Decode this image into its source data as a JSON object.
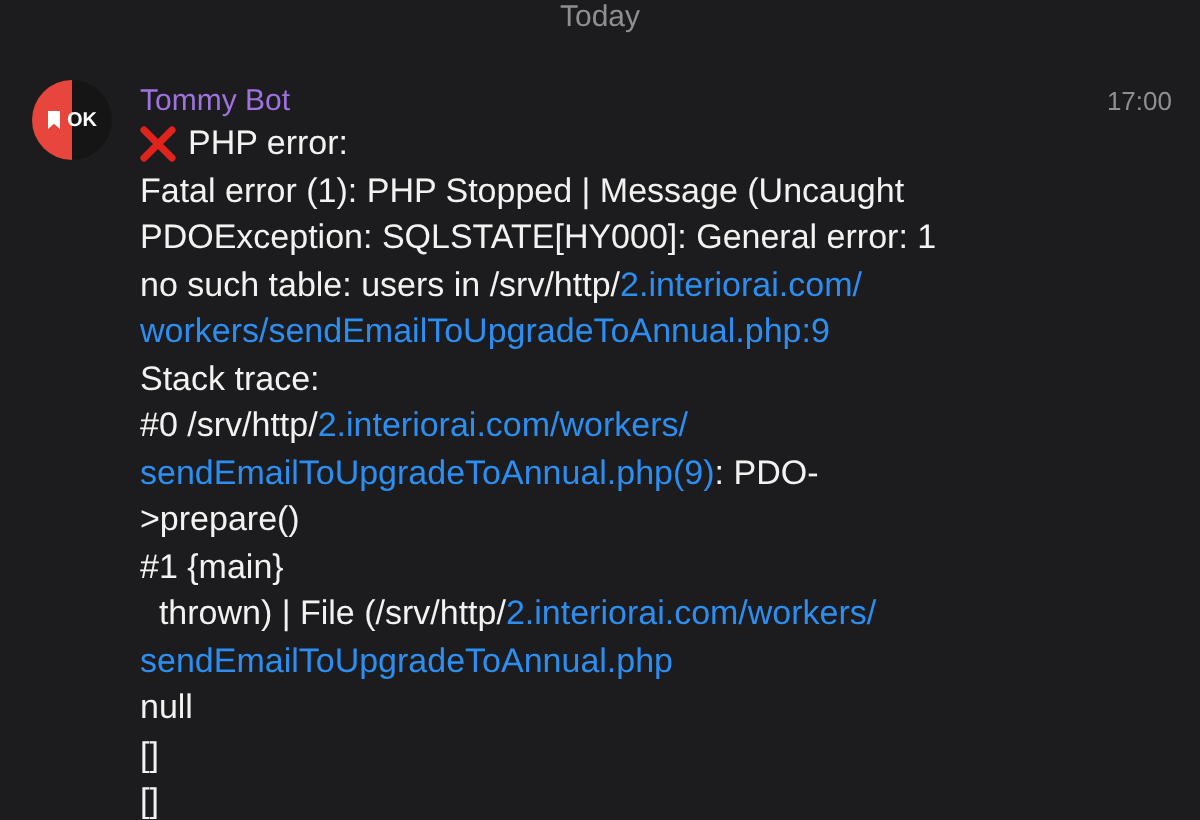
{
  "date_header": "Today",
  "message": {
    "avatar_text": "OK",
    "sender": "Tommy Bot",
    "time": "17:00",
    "lines": [
      {
        "kind": "error",
        "segments": [
          {
            "text": "PHP error:",
            "link": false
          }
        ]
      },
      {
        "kind": "text",
        "segments": [
          {
            "text": "Fatal error (1): PHP Stopped | Message (Uncaught",
            "link": false
          }
        ]
      },
      {
        "kind": "text",
        "segments": [
          {
            "text": "PDOException: SQLSTATE[HY000]: General error: 1",
            "link": false
          }
        ]
      },
      {
        "kind": "text",
        "segments": [
          {
            "text": "no such table: users in /srv/http/",
            "link": false
          },
          {
            "text": "2.interiorai.com/",
            "link": true
          }
        ]
      },
      {
        "kind": "text",
        "segments": [
          {
            "text": "workers/sendEmailToUpgradeToAnnual.php:9",
            "link": true
          }
        ]
      },
      {
        "kind": "text",
        "segments": [
          {
            "text": "Stack trace:",
            "link": false
          }
        ]
      },
      {
        "kind": "text",
        "segments": [
          {
            "text": "#0 /srv/http/",
            "link": false
          },
          {
            "text": "2.interiorai.com/workers/",
            "link": true
          }
        ]
      },
      {
        "kind": "text",
        "segments": [
          {
            "text": "sendEmailToUpgradeToAnnual.php(9)",
            "link": true
          },
          {
            "text": ": PDO-",
            "link": false
          }
        ]
      },
      {
        "kind": "text",
        "segments": [
          {
            "text": ">prepare()",
            "link": false
          }
        ]
      },
      {
        "kind": "text",
        "segments": [
          {
            "text": "#1 {main}",
            "link": false
          }
        ]
      },
      {
        "kind": "text",
        "segments": [
          {
            "text": "  thrown) | File (/srv/http/",
            "link": false
          },
          {
            "text": "2.interiorai.com/workers/",
            "link": true
          }
        ]
      },
      {
        "kind": "text",
        "segments": [
          {
            "text": "sendEmailToUpgradeToAnnual.php",
            "link": true
          }
        ]
      },
      {
        "kind": "text",
        "segments": [
          {
            "text": "null",
            "link": false
          }
        ]
      },
      {
        "kind": "text",
        "segments": [
          {
            "text": "[]",
            "link": false
          }
        ]
      },
      {
        "kind": "text",
        "segments": [
          {
            "text": "[]",
            "link": false
          }
        ]
      }
    ]
  }
}
